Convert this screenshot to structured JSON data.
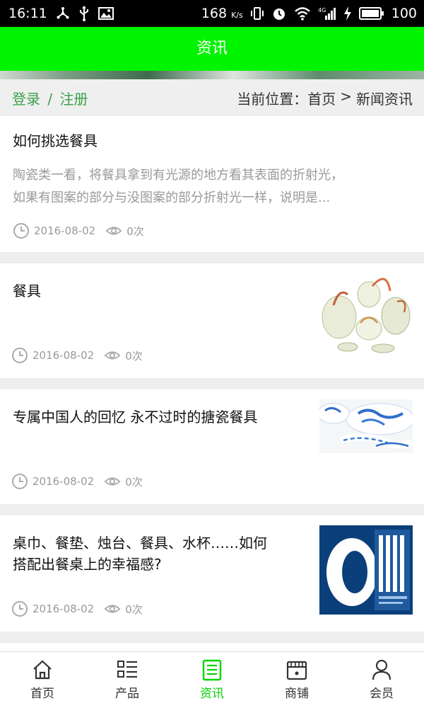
{
  "status_bar": {
    "time": "16:11",
    "speed": "168",
    "speed_unit": "K/s",
    "battery": "100"
  },
  "header": {
    "title": "资讯"
  },
  "location_bar": {
    "login": "登录",
    "separator": "/",
    "register": "注册",
    "current_label": "当前位置：",
    "home": "首页",
    "arrow": ">",
    "section": "新闻资讯"
  },
  "articles": [
    {
      "title": "如何挑选餐具",
      "summary_line1": "陶瓷类一看，将餐具拿到有光源的地方看其表面的折射光，",
      "summary_line2": "如果有图案的部分与没图案的部分折射光一样，说明是...",
      "date": "2016-08-02",
      "views": "0次"
    },
    {
      "title": "餐具",
      "date": "2016-08-02",
      "views": "0次",
      "thumb": "porcelain-tea-set-image"
    },
    {
      "title": "专属中国人的回忆 永不过时的搪瓷餐具",
      "date": "2016-08-02",
      "views": "0次",
      "thumb": "blue-white-enamel-dishes-image"
    },
    {
      "title_line1": "桌巾、餐垫、烛台、餐具、水杯……如何",
      "title_line2": "搭配出餐桌上的幸福感?",
      "date": "2016-08-02",
      "views": "0次",
      "thumb": "blue-logo-sign-image"
    }
  ],
  "bottom_nav": [
    {
      "label": "首页",
      "icon": "home-icon"
    },
    {
      "label": "产品",
      "icon": "list-icon"
    },
    {
      "label": "资讯",
      "icon": "news-icon",
      "active": true
    },
    {
      "label": "商铺",
      "icon": "shop-icon"
    },
    {
      "label": "会员",
      "icon": "user-icon"
    }
  ],
  "colors": {
    "accent": "#00f400",
    "active_tab": "#00d400",
    "login_link": "#3aa14a"
  }
}
